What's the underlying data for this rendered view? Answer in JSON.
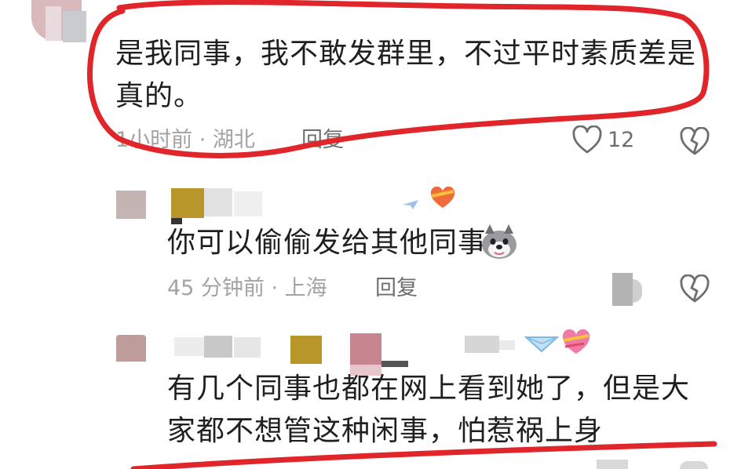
{
  "comments": [
    {
      "text": "是我同事，我不敢发群里，不过平时素质差是真的。",
      "time_location": "1小时前 · 湖北",
      "reply_label": "回复",
      "like_count": "12"
    },
    {
      "text": "你可以偷偷发给其他同事",
      "time_location": "45 分钟前 · 上海",
      "reply_label": "回复"
    },
    {
      "text": "有几个同事也都在网上看到她了，但是大家都不想管这种闲事，怕惹祸上身"
    }
  ],
  "icons": {
    "like": "heart-outline-icon",
    "dislike": "broken-heart-icon",
    "emoji_doge": "doge-emoji-icon",
    "badge_heart": "heart-badge-icon",
    "badge_plane": "paper-plane-badge-icon",
    "badge_diamond": "diamond-badge-icon"
  },
  "colors": {
    "annotation_red": "#e0262b",
    "text_primary": "#1f1f1f",
    "text_meta": "#a3a3a3",
    "icon_gray": "#6e6e6e"
  }
}
